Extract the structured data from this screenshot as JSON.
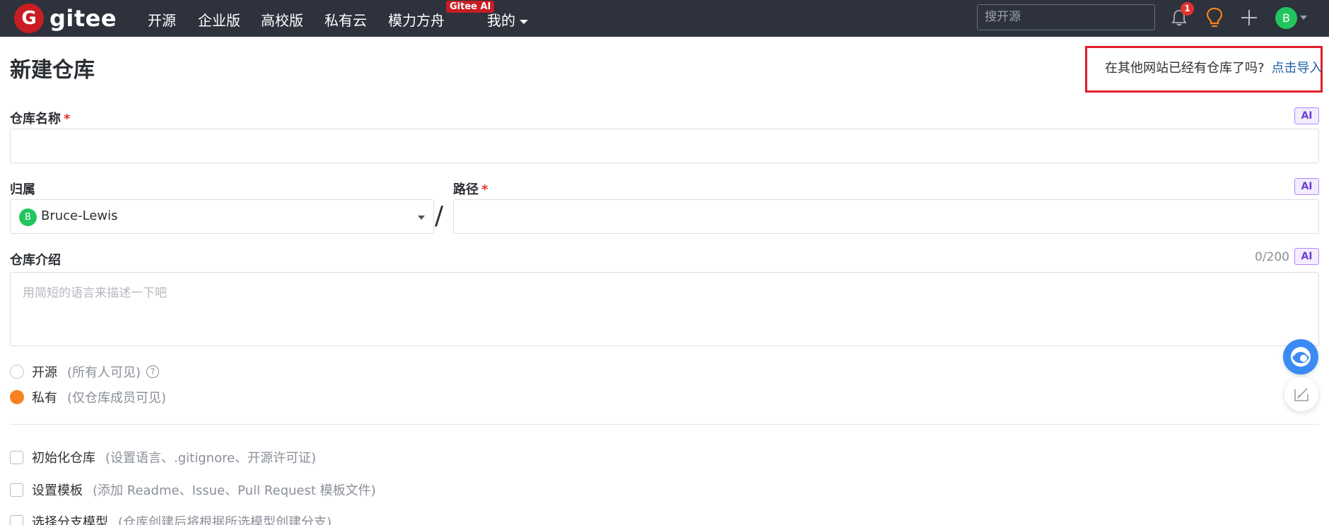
{
  "nav": {
    "logo_letter": "G",
    "logo_text": "gitee",
    "items": [
      "开源",
      "企业版",
      "高校版",
      "私有云",
      "模力方舟",
      "我的"
    ],
    "badge": "Gitee AI",
    "search_placeholder": "搜开源",
    "notification_count": "1",
    "avatar_letter": "B"
  },
  "page": {
    "title": "新建仓库",
    "import_prompt": "在其他网站已经有仓库了吗?",
    "import_link": "点击导入"
  },
  "form": {
    "repo_name_label": "仓库名称",
    "required_mark": "*",
    "ai_tag": "AI",
    "owner_label": "归属",
    "owner_avatar_letter": "B",
    "owner_value": "Bruce-Lewis",
    "separator": "/",
    "path_label": "路径",
    "intro_label": "仓库介绍",
    "intro_counter": "0/200",
    "intro_placeholder": "用简短的语言来描述一下吧",
    "visibility": [
      {
        "label": "开源",
        "sub": "(所有人可见)",
        "checked": false
      },
      {
        "label": "私有",
        "sub": "(仅仓库成员可见)",
        "checked": true
      }
    ],
    "help_glyph": "?",
    "options": [
      {
        "label": "初始化仓库",
        "sub": "(设置语言、.gitignore、开源许可证)"
      },
      {
        "label": "设置模板",
        "sub": "(添加 Readme、Issue、Pull Request 模板文件)"
      },
      {
        "label": "选择分支模型",
        "sub": "(仓库创建后将根据所选模型创建分支)"
      }
    ]
  }
}
